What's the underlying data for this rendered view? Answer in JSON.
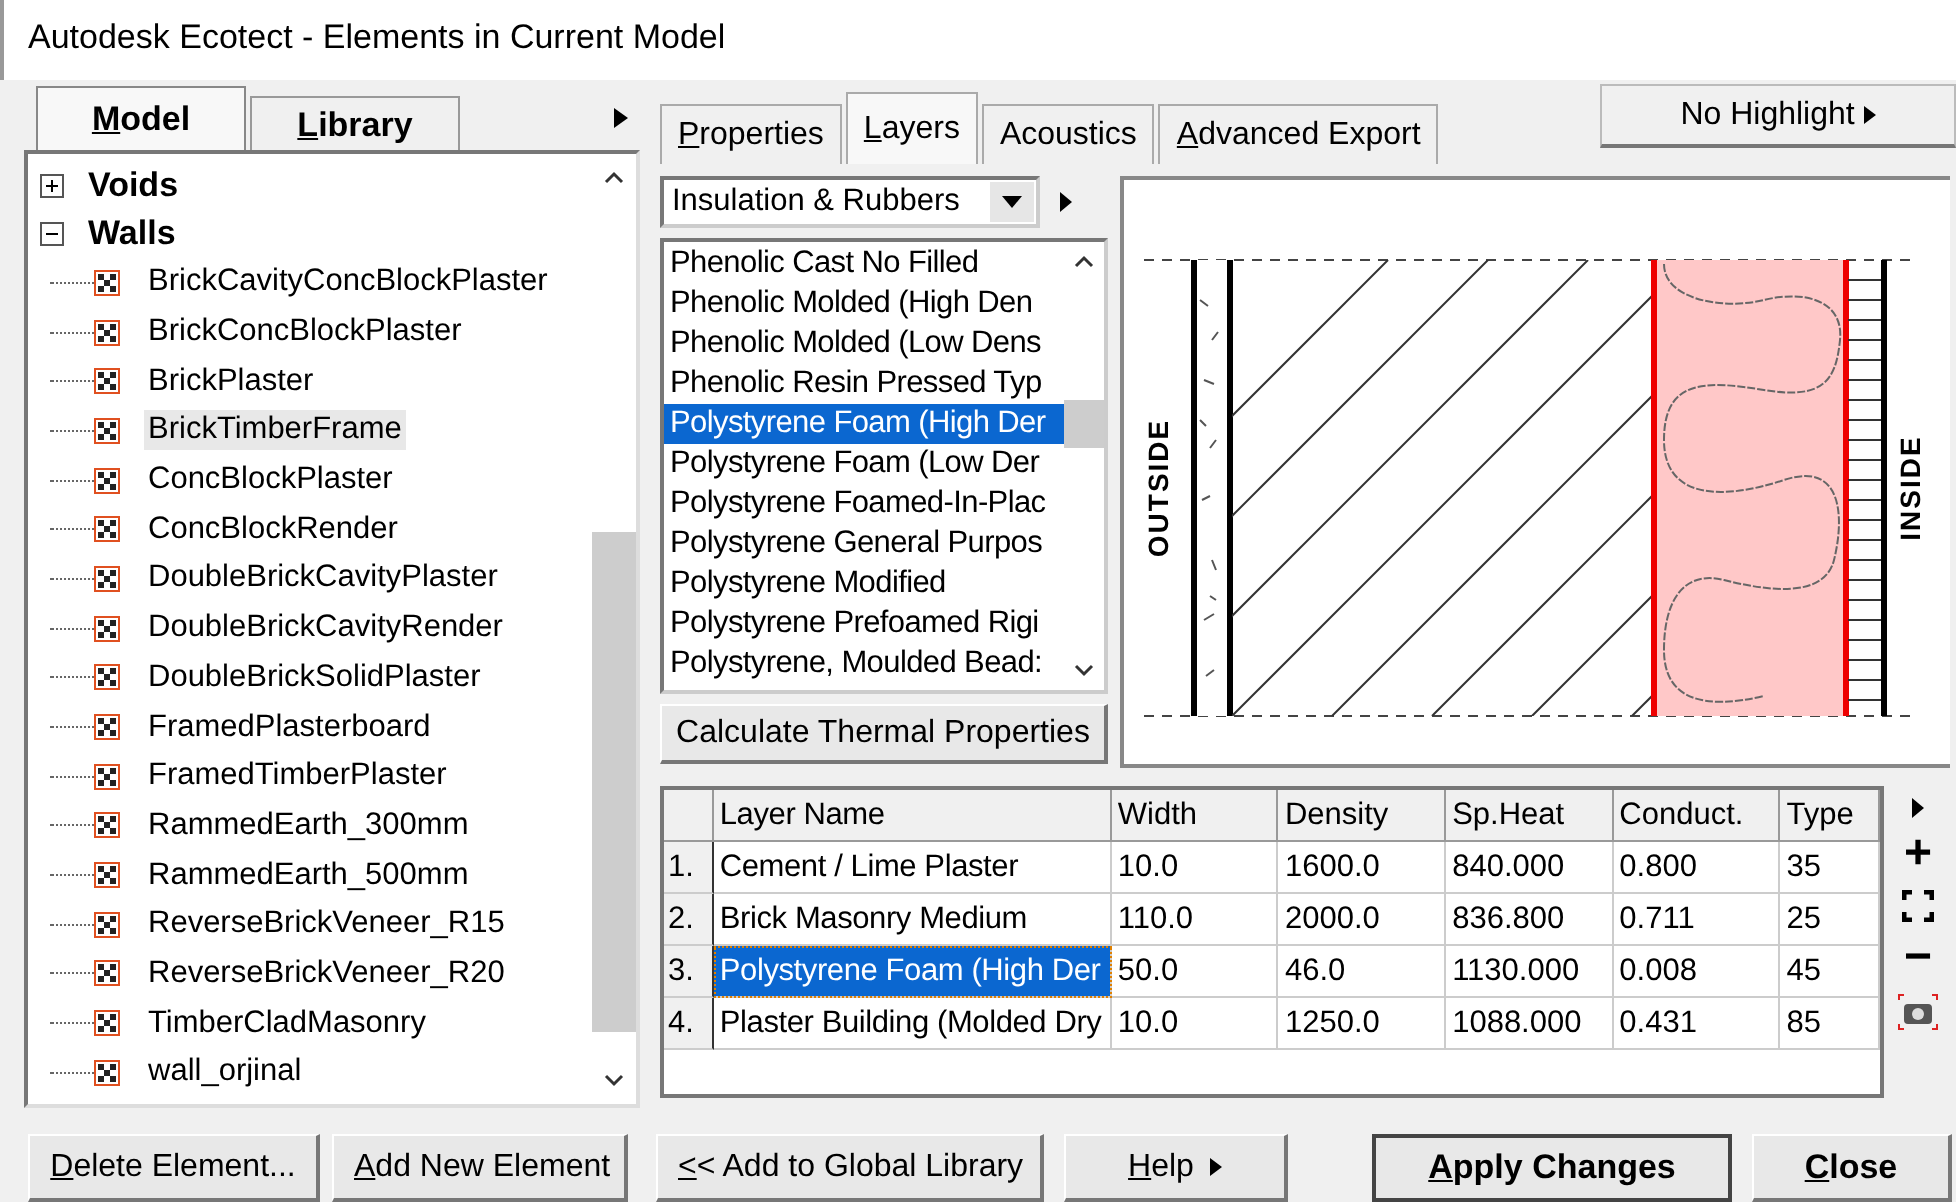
{
  "window": {
    "title": "Autodesk Ecotect - Elements in Current Model"
  },
  "left_tabs": [
    {
      "label": "Model",
      "selected": true
    },
    {
      "label": "Library",
      "selected": false
    }
  ],
  "tree": [
    {
      "label": "Voids",
      "expanded": false
    },
    {
      "label": "Walls",
      "expanded": true,
      "children": [
        {
          "label": "BrickCavityConcBlockPlaster",
          "selected": false
        },
        {
          "label": "BrickConcBlockPlaster",
          "selected": false
        },
        {
          "label": "BrickPlaster",
          "selected": false
        },
        {
          "label": "BrickTimberFrame",
          "selected": true
        },
        {
          "label": "ConcBlockPlaster",
          "selected": false
        },
        {
          "label": "ConcBlockRender",
          "selected": false
        },
        {
          "label": "DoubleBrickCavityPlaster",
          "selected": false
        },
        {
          "label": "DoubleBrickCavityRender",
          "selected": false
        },
        {
          "label": "DoubleBrickSolidPlaster",
          "selected": false
        },
        {
          "label": "FramedPlasterboard",
          "selected": false
        },
        {
          "label": "FramedTimberPlaster",
          "selected": false
        },
        {
          "label": "RammedEarth_300mm",
          "selected": false
        },
        {
          "label": "RammedEarth_500mm",
          "selected": false
        },
        {
          "label": "ReverseBrickVeneer_R15",
          "selected": false
        },
        {
          "label": "ReverseBrickVeneer_R20",
          "selected": false
        },
        {
          "label": "TimberCladMasonry",
          "selected": false
        },
        {
          "label": "wall_orjinal",
          "selected": false
        }
      ]
    }
  ],
  "right_tabs": [
    {
      "label": "Properties",
      "selected": false
    },
    {
      "label": "Layers",
      "selected": true
    },
    {
      "label": "Acoustics",
      "selected": false
    },
    {
      "label": "Advanced Export",
      "selected": false
    }
  ],
  "highlight_button": "No Highlight",
  "category_dropdown": {
    "value": "Insulation & Rubbers"
  },
  "materials": [
    {
      "label": "Phenolic Cast No Filled",
      "selected": false
    },
    {
      "label": "Phenolic Molded (High Den",
      "selected": false
    },
    {
      "label": "Phenolic Molded (Low Dens",
      "selected": false
    },
    {
      "label": "Phenolic Resin Pressed Typ",
      "selected": false
    },
    {
      "label": "Polystyrene Foam (High Der",
      "selected": true
    },
    {
      "label": "Polystyrene Foam (Low Der",
      "selected": false
    },
    {
      "label": "Polystyrene Foamed-In-Plac",
      "selected": false
    },
    {
      "label": "Polystyrene General Purpos",
      "selected": false
    },
    {
      "label": "Polystyrene Modified",
      "selected": false
    },
    {
      "label": "Polystyrene Prefoamed Rigi",
      "selected": false
    },
    {
      "label": "Polystyrene, Moulded Bead:",
      "selected": false
    }
  ],
  "calculate_button": "Calculate Thermal Properties",
  "section": {
    "outside_label": "OUTSIDE",
    "inside_label": "INSIDE"
  },
  "table": {
    "columns": [
      "Layer Name",
      "Width",
      "Density",
      "Sp.Heat",
      "Conduct.",
      "Type"
    ],
    "rows": [
      {
        "index": "1.",
        "cells": [
          "Cement / Lime Plaster",
          "10.0",
          "1600.0",
          "840.000",
          "0.800",
          "35"
        ],
        "selected": false
      },
      {
        "index": "2.",
        "cells": [
          "Brick Masonry Medium",
          "110.0",
          "2000.0",
          "836.800",
          "0.711",
          "25"
        ],
        "selected": false
      },
      {
        "index": "3.",
        "cells": [
          "Polystyrene Foam (High Der",
          "50.0",
          "46.0",
          "1130.000",
          "0.008",
          "45"
        ],
        "selected": true
      },
      {
        "index": "4.",
        "cells": [
          "Plaster Building (Molded Dry",
          "10.0",
          "1250.0",
          "1088.000",
          "0.431",
          "85"
        ],
        "selected": false
      }
    ]
  },
  "side_tools": [
    "+",
    "−"
  ],
  "buttons": [
    {
      "label": "Delete Element...",
      "kind": "plain"
    },
    {
      "label": "Add New Element",
      "kind": "plain"
    },
    {
      "label": "<< Add to Global Library",
      "kind": "plain"
    },
    {
      "label": "Help",
      "kind": "menu"
    },
    {
      "label": "Apply Changes",
      "kind": "default"
    },
    {
      "label": "Close",
      "kind": "bold"
    }
  ]
}
